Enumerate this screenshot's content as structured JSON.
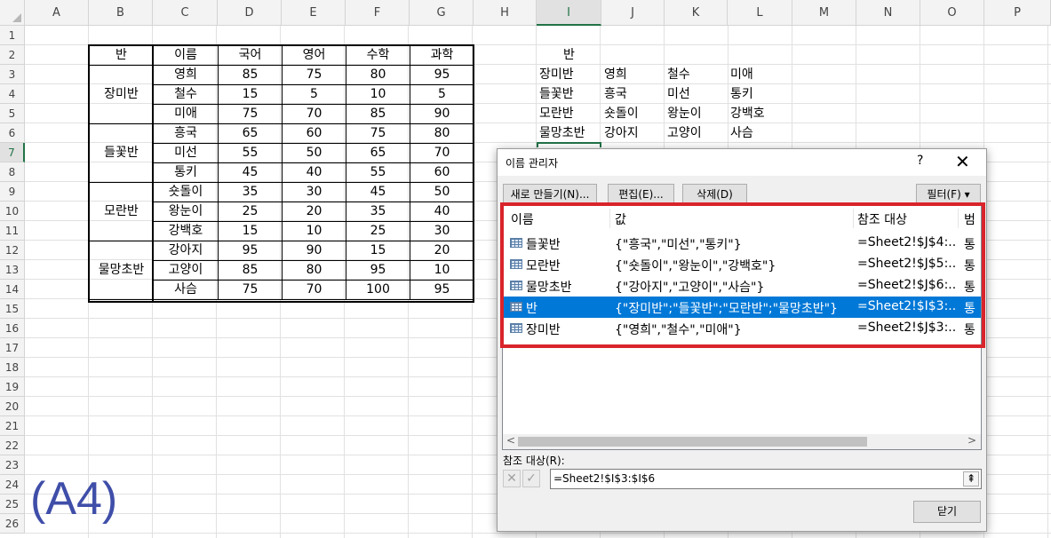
{
  "sheet": {
    "columns": [
      "A",
      "B",
      "C",
      "D",
      "E",
      "F",
      "G",
      "H",
      "I",
      "J",
      "K",
      "L",
      "M",
      "N",
      "O",
      "P"
    ],
    "rows": [
      "1",
      "2",
      "3",
      "4",
      "5",
      "6",
      "7",
      "8",
      "9",
      "10",
      "11",
      "12",
      "13",
      "14",
      "15",
      "16",
      "17",
      "18",
      "19",
      "20",
      "21",
      "22",
      "23",
      "24",
      "25",
      "26"
    ],
    "table": {
      "headers": [
        "반",
        "이름",
        "국어",
        "영어",
        "수학",
        "과학"
      ],
      "groups": [
        "장미반",
        "들꽃반",
        "모란반",
        "물망초반"
      ],
      "rows": [
        [
          "영희",
          "85",
          "75",
          "80",
          "95"
        ],
        [
          "철수",
          "15",
          "5",
          "10",
          "5"
        ],
        [
          "미애",
          "75",
          "70",
          "85",
          "90"
        ],
        [
          "흥국",
          "65",
          "60",
          "75",
          "80"
        ],
        [
          "미선",
          "55",
          "50",
          "65",
          "70"
        ],
        [
          "통키",
          "45",
          "40",
          "55",
          "60"
        ],
        [
          "숏돌이",
          "35",
          "30",
          "45",
          "50"
        ],
        [
          "왕눈이",
          "25",
          "20",
          "35",
          "40"
        ],
        [
          "강백호",
          "15",
          "10",
          "25",
          "30"
        ],
        [
          "강아지",
          "95",
          "90",
          "15",
          "20"
        ],
        [
          "고양이",
          "85",
          "80",
          "95",
          "10"
        ],
        [
          "사슴",
          "75",
          "70",
          "100",
          "95"
        ]
      ]
    },
    "side_table": {
      "header": "반",
      "rows": [
        [
          "장미반",
          "영희",
          "철수",
          "미애"
        ],
        [
          "들꽃반",
          "흥국",
          "미선",
          "통키"
        ],
        [
          "모란반",
          "숏돌이",
          "왕눈이",
          "강백호"
        ],
        [
          "물망초반",
          "강아지",
          "고양이",
          "사슴"
        ]
      ]
    },
    "overlay_label": "(A4)"
  },
  "dialog": {
    "title": "이름 관리자",
    "help": "?",
    "close": "✕",
    "buttons": {
      "new": "새로 만들기(N)...",
      "edit": "편집(E)...",
      "delete": "삭제(D)",
      "filter": "필터(F) ▾"
    },
    "list_headers": [
      "이름",
      "값",
      "참조 대상",
      "범"
    ],
    "list": [
      {
        "name": "들꽃반",
        "value": "{\"흥국\",\"미선\",\"통키\"}",
        "ref": "=Sheet2!$J$4:...",
        "scope": "통"
      },
      {
        "name": "모란반",
        "value": "{\"숏돌이\",\"왕눈이\",\"강백호\"}",
        "ref": "=Sheet2!$J$5:...",
        "scope": "통"
      },
      {
        "name": "물망초반",
        "value": "{\"강아지\",\"고양이\",\"사슴\"}",
        "ref": "=Sheet2!$J$6:...",
        "scope": "통"
      },
      {
        "name": "반",
        "value": "{\"장미반\";\"들꽃반\";\"모란반\";\"물망초반\"}",
        "ref": "=Sheet2!$I$3:...",
        "scope": "통"
      },
      {
        "name": "장미반",
        "value": "{\"영희\",\"철수\",\"미애\"}",
        "ref": "=Sheet2!$J$3:...",
        "scope": "통"
      }
    ],
    "selected_index": 3,
    "ref_label": "참조 대상(R):",
    "ref_value": "=Sheet2!$I$3:$I$6",
    "close_button": "닫기"
  }
}
